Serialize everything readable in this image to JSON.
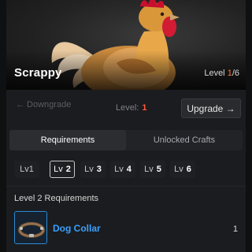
{
  "hero": {
    "name": "Scrappy",
    "level_prefix": "Level ",
    "level_current": "1",
    "level_suffix": "/6"
  },
  "level_control": {
    "downgrade_label": "← Downgrade",
    "level_label": "Level:",
    "level_value": "1",
    "upgrade_label": "Upgrade →"
  },
  "tabs": [
    {
      "label": "Requirements"
    },
    {
      "label": "Unlocked Crafts"
    }
  ],
  "level_chips": [
    {
      "prefix": "Lv",
      "num": "1"
    },
    {
      "prefix": "Lv",
      "num": "2"
    },
    {
      "prefix": "Lv",
      "num": "3"
    },
    {
      "prefix": "Lv",
      "num": "4"
    },
    {
      "prefix": "Lv",
      "num": "5"
    },
    {
      "prefix": "Lv",
      "num": "6"
    }
  ],
  "requirements": {
    "title": "Level 2 Requirements",
    "items": [
      {
        "name": "Dog Collar",
        "qty": "1"
      }
    ]
  },
  "colors": {
    "accent": "#ff7a3a",
    "link": "#3aa0ff",
    "panel": "#1b1c1f"
  }
}
